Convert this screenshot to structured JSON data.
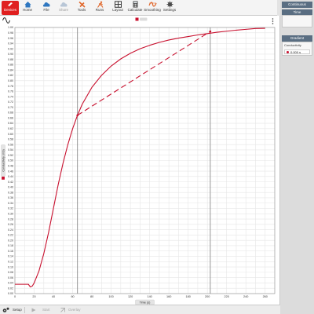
{
  "toolbar": {
    "items": [
      {
        "label": "Devices",
        "icon": "devices-icon"
      },
      {
        "label": "Home",
        "icon": "home-icon"
      },
      {
        "label": "File",
        "icon": "cloud-icon"
      },
      {
        "label": "Share",
        "icon": "share-cloud-icon"
      },
      {
        "label": "Tools",
        "icon": "tools-icon"
      },
      {
        "label": "Runs",
        "icon": "runs-icon"
      },
      {
        "label": "Layout",
        "icon": "layout-icon"
      },
      {
        "label": "Calculate",
        "icon": "calculator-icon"
      },
      {
        "label": "Smoothing",
        "icon": "smoothing-icon"
      },
      {
        "label": "Settings",
        "icon": "gear-icon"
      }
    ]
  },
  "side": {
    "continuous": "Continuous",
    "time": "Time",
    "gradient": "Gradient",
    "gradient_series": "Conductivity",
    "gradient_value": "0.000 s"
  },
  "bottom": {
    "setup": "Setup",
    "start": "Start",
    "overlay": "Overlay"
  },
  "colors": {
    "accent": "#c8102e",
    "sidebar_header": "#5a6e82"
  },
  "chart_data": {
    "type": "line",
    "xlabel": "Time (s)",
    "ylabel": "Conductivity (mS)",
    "xlim": [
      0,
      270
    ],
    "ylim": [
      0,
      1.0
    ],
    "xticks": [
      0,
      20,
      40,
      60,
      80,
      100,
      120,
      140,
      160,
      180,
      200,
      220,
      240,
      260
    ],
    "yticks": [
      "0.00",
      "0.02",
      "0.04",
      "0.06",
      "0.08",
      "0.10",
      "0.12",
      "0.14",
      "0.16",
      "0.18",
      "0.20",
      "0.22",
      "0.24",
      "0.26",
      "0.28",
      "0.30",
      "0.32",
      "0.34",
      "0.36",
      "0.38",
      "0.40",
      "0.42",
      "0.44",
      "0.46",
      "0.48",
      "0.50",
      "0.52",
      "0.54",
      "0.56",
      "0.58",
      "0.60",
      "0.62",
      "0.64",
      "0.66",
      "0.68",
      "0.70",
      "0.72",
      "0.74",
      "0.76",
      "0.78",
      "0.80",
      "0.82",
      "0.84",
      "0.86",
      "0.88",
      "0.90",
      "0.92",
      "0.94",
      "0.96",
      "0.98",
      "1.00"
    ],
    "grid": true,
    "series": [
      {
        "color": "#c8102e",
        "x": [
          0,
          10,
          14,
          16,
          18,
          20,
          25,
          30,
          35,
          40,
          45,
          50,
          55,
          60,
          65,
          70,
          80,
          90,
          100,
          110,
          120,
          130,
          140,
          150,
          160,
          170,
          180,
          190,
          200,
          210,
          220,
          230,
          240,
          250,
          260
        ],
        "y": [
          0.035,
          0.035,
          0.035,
          0.025,
          0.028,
          0.04,
          0.085,
          0.15,
          0.23,
          0.32,
          0.41,
          0.49,
          0.56,
          0.62,
          0.67,
          0.712,
          0.775,
          0.82,
          0.855,
          0.882,
          0.903,
          0.92,
          0.933,
          0.944,
          0.953,
          0.96,
          0.966,
          0.972,
          0.977,
          0.982,
          0.986,
          0.99,
          0.993,
          0.996,
          0.997
        ]
      }
    ],
    "tangent": {
      "x": [
        65,
        203
      ],
      "y": [
        0.67,
        0.985
      ]
    },
    "cursors": [
      65,
      203
    ]
  }
}
